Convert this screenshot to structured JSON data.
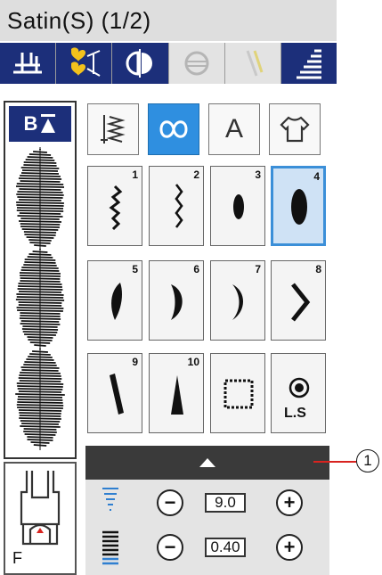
{
  "title": "Satin(S) (1/2)",
  "function_bar": {
    "items": [
      {
        "icon": "needle-plate-icon",
        "state": "active"
      },
      {
        "icon": "heart-memory-icon",
        "state": "active"
      },
      {
        "icon": "mirror-image-icon",
        "state": "active"
      },
      {
        "icon": "elongation-icon",
        "state": "disabled"
      },
      {
        "icon": "twin-needle-icon",
        "state": "disabled"
      },
      {
        "icon": "stitch-density-icon",
        "state": "active"
      }
    ]
  },
  "sidebar": {
    "category_label": "B"
  },
  "category_tabs": [
    {
      "icon": "utility-stitch-icon",
      "selected": false
    },
    {
      "icon": "satin-stitch-icon",
      "selected": true
    },
    {
      "label": "A",
      "selected": false
    },
    {
      "icon": "garment-icon",
      "selected": false
    }
  ],
  "patterns": [
    {
      "number": "1",
      "selected": false
    },
    {
      "number": "2",
      "selected": false
    },
    {
      "number": "3",
      "selected": false
    },
    {
      "number": "4",
      "selected": true
    },
    {
      "number": "5",
      "selected": false
    },
    {
      "number": "6",
      "selected": false
    },
    {
      "number": "7",
      "selected": false
    },
    {
      "number": "8",
      "selected": false
    },
    {
      "number": "9",
      "selected": false
    },
    {
      "number": "10",
      "selected": false
    },
    {
      "number": "",
      "selected": false
    },
    {
      "label": "L.S",
      "selected": false
    }
  ],
  "settings": {
    "width": {
      "value": "9.0",
      "minus": "−",
      "plus": "+"
    },
    "length": {
      "value": "0.40",
      "minus": "−",
      "plus": "+"
    }
  },
  "presser_foot": {
    "label": "F"
  },
  "callout": {
    "label": "1"
  },
  "colors": {
    "accent_dark": "#1c2f7a",
    "selection_blue": "#3b8fd8",
    "callout_red": "#d8231f"
  }
}
